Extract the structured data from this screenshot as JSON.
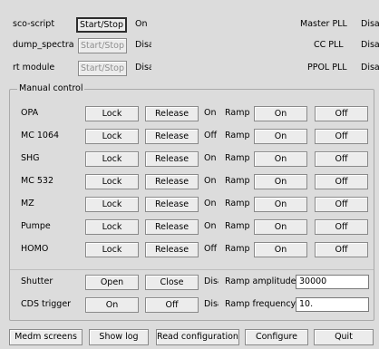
{
  "top": {
    "sco_script": {
      "label": "sco-script",
      "button": "Start/Stop",
      "status": "On"
    },
    "dump_spectra": {
      "label": "dump_spectra",
      "button": "Start/Stop",
      "status": "Disabled"
    },
    "rt_module": {
      "label": "rt module",
      "button": "Start/Stop",
      "status": "Disabled"
    },
    "master_pll": {
      "label": "Master PLL",
      "status": "Disabled"
    },
    "cc_pll": {
      "label": "CC PLL",
      "status": "Disabled"
    },
    "ppol_pll": {
      "label": "PPOL PLL",
      "status": "Disabled"
    }
  },
  "manual": {
    "title": "Manual control",
    "lock_label": "Lock",
    "release_label": "Release",
    "ramp_label": "Ramp",
    "on_label": "On",
    "off_label": "Off",
    "rows": [
      {
        "name": "OPA",
        "state": "On"
      },
      {
        "name": "MC 1064",
        "state": "Off"
      },
      {
        "name": "SHG",
        "state": "On"
      },
      {
        "name": "MC 532",
        "state": "On"
      },
      {
        "name": "MZ",
        "state": "On"
      },
      {
        "name": "Pumpe",
        "state": "On"
      },
      {
        "name": "HOMO",
        "state": "Off"
      }
    ],
    "shutter": {
      "label": "Shutter",
      "open": "Open",
      "close": "Close",
      "status": "Disabled"
    },
    "cds": {
      "label": "CDS trigger",
      "on": "On",
      "off": "Off",
      "status": "Disabled"
    },
    "ramp_amplitude": {
      "label": "Ramp amplitude",
      "value": "30000"
    },
    "ramp_frequency": {
      "label": "Ramp frequency",
      "value": "10."
    }
  },
  "bottom": {
    "medm": "Medm screens",
    "show_log": "Show log",
    "read_config": "Read configuration",
    "configure": "Configure",
    "quit": "Quit"
  }
}
